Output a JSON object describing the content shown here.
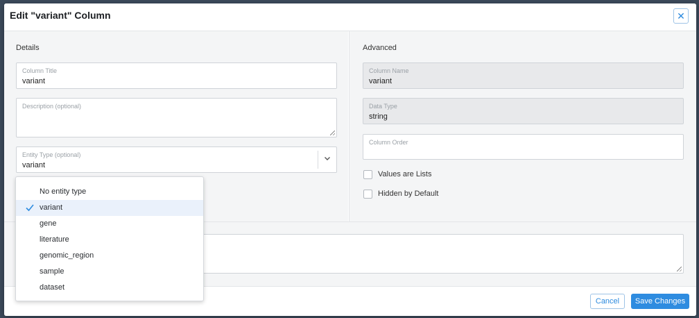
{
  "dialog": {
    "title": "Edit \"variant\" Column",
    "close_glyph": "✕"
  },
  "details": {
    "section_title": "Details",
    "column_title": {
      "label": "Column Title",
      "value": "variant"
    },
    "description": {
      "label": "Description (optional)",
      "value": ""
    },
    "entity_type": {
      "label": "Entity Type (optional)",
      "value": "variant"
    }
  },
  "advanced": {
    "section_title": "Advanced",
    "column_name": {
      "label": "Column Name",
      "value": "variant"
    },
    "data_type": {
      "label": "Data Type",
      "value": "string"
    },
    "column_order": {
      "label": "Column Order",
      "value": ""
    },
    "values_are_lists": {
      "label": "Values are Lists",
      "checked": false
    },
    "hidden_by_default": {
      "label": "Hidden by Default",
      "checked": false
    }
  },
  "entity_dropdown": {
    "selected": "variant",
    "options": [
      "No entity type",
      "variant",
      "gene",
      "literature",
      "genomic_region",
      "sample",
      "dataset"
    ]
  },
  "footer": {
    "cancel_label": "Cancel",
    "save_label": "Save Changes"
  },
  "colors": {
    "accent": "#2e8ce0",
    "panel_bg": "#f4f5f6",
    "disabled_bg": "#e8e9eb",
    "selected_option_bg": "#eaf1fb"
  }
}
